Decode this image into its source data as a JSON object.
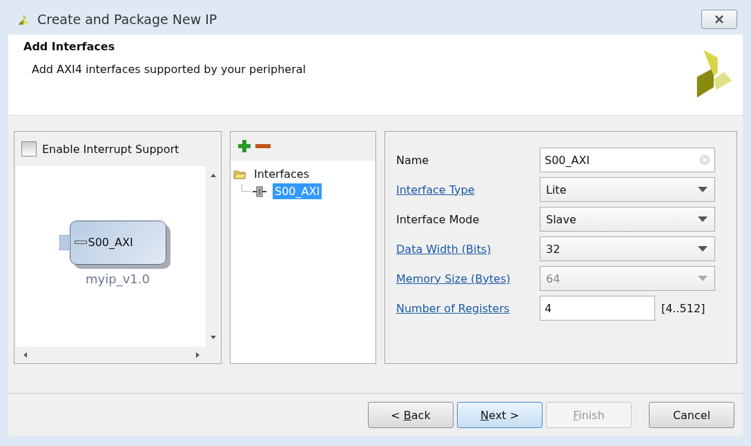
{
  "window": {
    "title": "Create and Package New IP"
  },
  "header": {
    "title": "Add Interfaces",
    "subtitle": "Add AXI4 interfaces supported by your peripheral"
  },
  "interrupt": {
    "label": "Enable Interrupt Support",
    "checked": false
  },
  "symbol": {
    "port": "S00_AXI",
    "name": "myip_v1.0"
  },
  "tree": {
    "label": "Interfaces",
    "expanded": true,
    "children": [
      {
        "label": "S00_AXI",
        "selected": true
      }
    ]
  },
  "form": [
    {
      "kind": "text",
      "label": "Name",
      "link": false,
      "value": "S00_AXI",
      "disabled": false
    },
    {
      "kind": "dropdown",
      "label": "Interface Type",
      "link": true,
      "value": "Lite",
      "disabled": false
    },
    {
      "kind": "dropdown",
      "label": "Interface Mode",
      "link": false,
      "value": "Slave",
      "disabled": false
    },
    {
      "kind": "dropdown",
      "label": "Data Width (Bits)",
      "link": true,
      "value": "32",
      "disabled": false
    },
    {
      "kind": "dropdown",
      "label": "Memory Size (Bytes)",
      "link": true,
      "value": "64",
      "disabled": true
    },
    {
      "kind": "number",
      "label": "Number of Registers",
      "link": true,
      "value": "4",
      "disabled": false,
      "suffix": "[4..512]"
    }
  ],
  "buttons": [
    {
      "before": "< ",
      "key": "B",
      "after": "ack",
      "disabled": false,
      "default": false
    },
    {
      "key": "N",
      "after": "ext >",
      "disabled": false,
      "default": true
    },
    {
      "key": "F",
      "after": "inish",
      "disabled": true,
      "default": false
    },
    {
      "before": "Cancel",
      "disabled": false,
      "default": false
    }
  ]
}
